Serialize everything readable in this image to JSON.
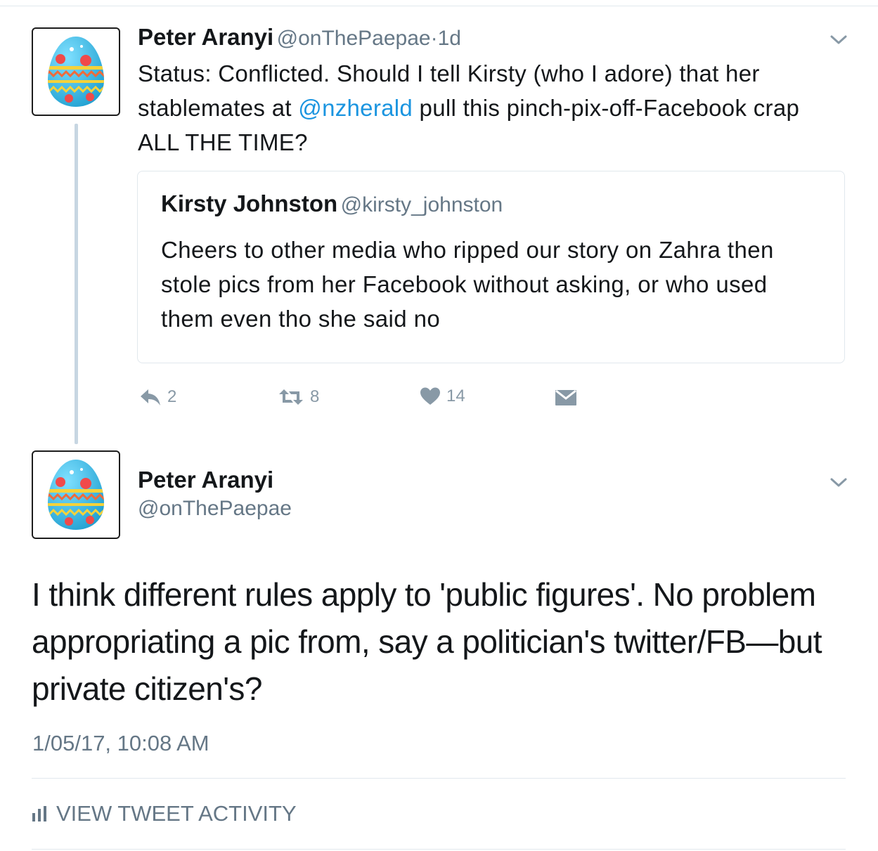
{
  "parent_tweet": {
    "display_name": "Peter Aranyi",
    "handle": "@onThePaepae",
    "separator": "·",
    "age": "1d",
    "text_before_mention": "Status: Conflicted. Should I tell Kirsty (who I adore) that her stablemates at ",
    "mention": "@nzherald",
    "text_after_mention": " pull this pinch-pix-off-Facebook crap ALL THE TIME?",
    "quoted_tweet": {
      "display_name": "Kirsty Johnston",
      "handle": "@kirsty_johnston",
      "text": "Cheers to other media who ripped our story on Zahra then stole pics from her Facebook without asking, or who used them even tho she said no"
    },
    "actions": {
      "reply_icon": "reply-icon",
      "reply_count": "2",
      "retweet_icon": "retweet-icon",
      "retweet_count": "8",
      "like_icon": "heart-icon",
      "like_count": "14",
      "dm_icon": "envelope-icon"
    }
  },
  "focused_tweet": {
    "display_name": "Peter Aranyi",
    "handle": "@onThePaepae",
    "text": "I think different rules apply to 'public figures'. No problem appropriating a pic from, say a politician's twitter/FB—but private citizen's?",
    "timestamp": "1/05/17, 10:08 AM",
    "activity_label": "VIEW TWEET ACTIVITY",
    "activity_icon": "bar-chart-icon"
  },
  "colors": {
    "link": "#1b95e0",
    "secondary_text": "#657786",
    "icon_gray": "#8899a6",
    "thread_line": "#c7d6e2",
    "divider": "#e1e8ed"
  }
}
